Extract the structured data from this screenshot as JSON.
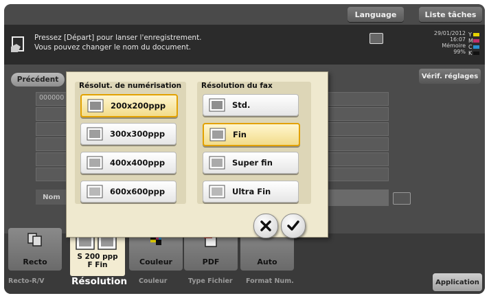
{
  "topbar": {
    "language": "Language",
    "liste_taches": "Liste tâches"
  },
  "message": {
    "line1": "Pressez [Départ] pour lanser l'enregistrement.",
    "line2": "Vous pouvez changer le nom du document."
  },
  "status": {
    "date": "29/01/2012",
    "time": "16:07",
    "memory_label": "Mémoire",
    "memory_value": "99%",
    "toner_labels": [
      "Y",
      "M",
      "C",
      "K"
    ],
    "toner_colors": [
      "#e6d200",
      "#c0306a",
      "#2a8fd0",
      "#111111"
    ]
  },
  "nav": {
    "precedent": "Précédent",
    "verif": "Vérif. réglages"
  },
  "list": {
    "row1": "000000"
  },
  "name_label": "Nom",
  "popup": {
    "scan_title": "Résolut. de numérisation",
    "scan_options": [
      "200x200ppp",
      "300x300ppp",
      "400x400ppp",
      "600x600ppp"
    ],
    "scan_selected": "200x200ppp",
    "fax_title": "Résolution du fax",
    "fax_options": [
      "Std.",
      "Fin",
      "Super fin",
      "Ultra Fin"
    ],
    "fax_selected": "Fin"
  },
  "tiles": {
    "recto": "Recto",
    "resolution_line1": "S 200 ppp",
    "resolution_line2": "F Fin",
    "couleur": "Couleur",
    "pdf": "PDF",
    "auto": "Auto"
  },
  "subs": {
    "recto": "Recto-R/V",
    "resolution": "Résolution",
    "couleur": "Couleur",
    "type_fichier": "Type Fichier",
    "format_num": "Format Num."
  },
  "application": "Application"
}
